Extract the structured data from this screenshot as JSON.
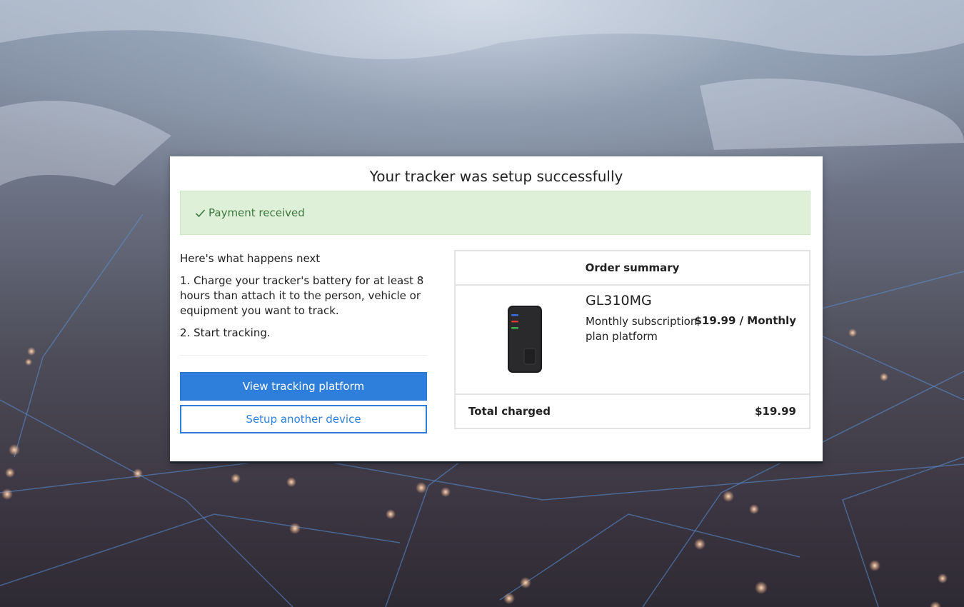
{
  "title": "Your tracker was setup successfully",
  "alert": {
    "icon": "check-icon",
    "text": "Payment received",
    "color": "#3c763d",
    "background": "#dff0d8"
  },
  "next": {
    "heading": "Here's what happens next",
    "steps": [
      "1. Charge your tracker's battery for at least 8 hours than attach it to the person, vehicle or equipment you want to track.",
      "2. Start tracking."
    ]
  },
  "buttons": {
    "primary": "View tracking platform",
    "secondary": "Setup another device"
  },
  "summary": {
    "heading": "Order summary",
    "product": {
      "image": "gps-tracker-device",
      "name": "GL310MG",
      "description": "Monthly subscription plan platform",
      "price": "$19.99 / Monthly"
    },
    "total_label": "Total charged",
    "total_value": "$19.99"
  },
  "colors": {
    "accent": "#2e7fdb"
  }
}
